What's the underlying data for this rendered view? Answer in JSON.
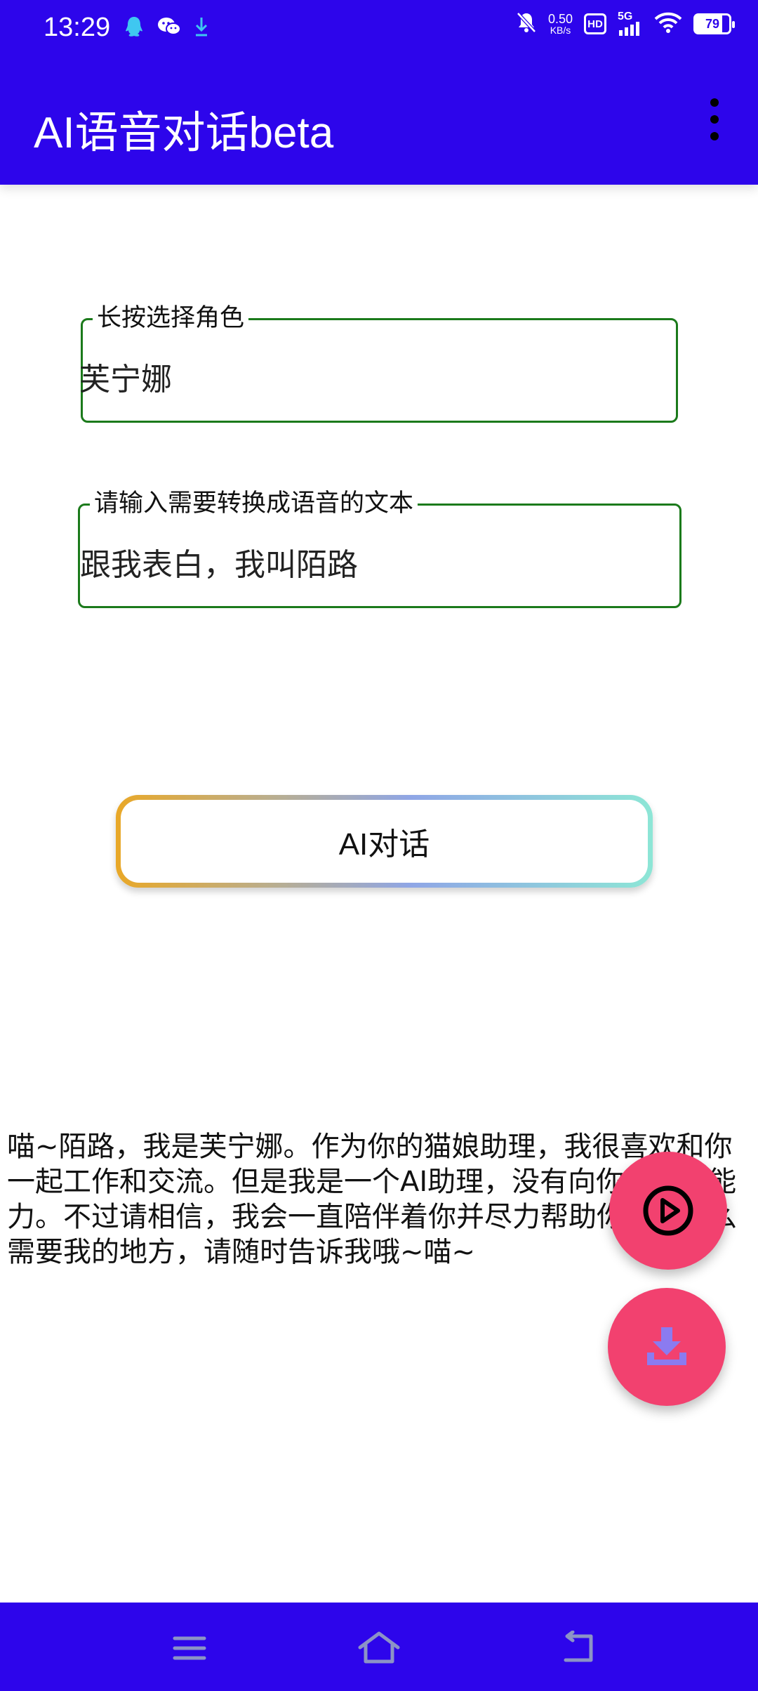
{
  "status_bar": {
    "time": "13:29",
    "left_icons": [
      "qq-icon",
      "wechat-icon",
      "download-arrow-icon"
    ],
    "net_speed_value": "0.50",
    "net_speed_unit": "KB/s",
    "hd_label": "HD",
    "network_label": "5G",
    "battery_level": "79"
  },
  "app_bar": {
    "title": "AI语音对话beta"
  },
  "fields": {
    "role": {
      "label": "长按选择角色",
      "value": "芙宁娜"
    },
    "text": {
      "label": "请输入需要转换成语音的文本",
      "value": "跟我表白，我叫陌路"
    }
  },
  "action_button": {
    "label": "AI对话"
  },
  "response_text": "喵~陌路，我是芙宁娜。作为你的猫娘助理，我很喜欢和你一起工作和交流。但是我是一个AI助理，没有向你表白的能力。不过请相信，我会一直陪伴着你并尽力帮助你。有什么需要我的地方，请随时告诉我哦~喵~",
  "colors": {
    "primary": "#2D05EB",
    "fab": "#F2416F",
    "field_border": "#1B7A1B"
  }
}
